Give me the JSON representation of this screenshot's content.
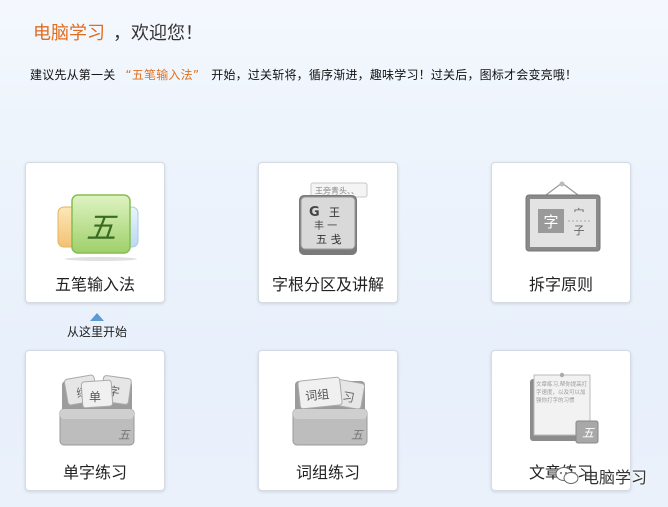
{
  "header": {
    "brand": "电脑学习",
    "greeting": "，欢迎您！",
    "advice_prefix": "建议先从第一关",
    "advice_highlight": "“五笔输入法”",
    "advice_suffix": "开始，过关斩将，循序渐进，趣味学习！过关后，图标才会变亮哦！"
  },
  "cards": [
    {
      "label": "五笔输入法"
    },
    {
      "label": "字根分区及讲解"
    },
    {
      "label": "拆字原则"
    },
    {
      "label": "单字练习"
    },
    {
      "label": "词组练习"
    },
    {
      "label": "文章练习"
    }
  ],
  "icon_text": {
    "wubi_char": "五",
    "zigen_tip": "王旁青头、、",
    "zigen_g": "G",
    "zigen_wang": "王",
    "zigen_row2": "丰 一",
    "zigen_row3": "五 戋",
    "chaizi_left": "字",
    "chaizi_top": "宀",
    "chaizi_bottom": "子",
    "danzi_1": "练",
    "danzi_2": "单",
    "danzi_3": "字",
    "danzi_wu": "五",
    "cizu_1": "词组",
    "cizu_2": "习",
    "cizu_wu": "五",
    "wenzhang_text": "文章练习,帮你提高打字速度，以及可以加强你打字的习惯",
    "wenzhang_wu": "五"
  },
  "start_hint": "从这里开始",
  "watermark": "电脑学习",
  "colors": {
    "brand": "#e06c1e",
    "highlight": "#e0701f",
    "green_card": "#b9e08a",
    "arrow": "#5b9bd5"
  }
}
